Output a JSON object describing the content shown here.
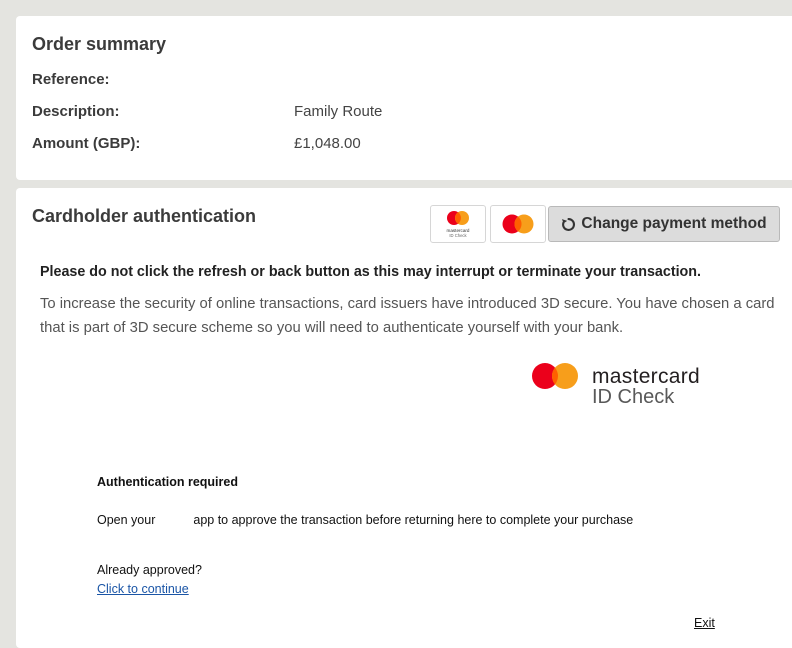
{
  "order_summary": {
    "title": "Order summary",
    "rows": [
      {
        "label": "Reference:",
        "value": ""
      },
      {
        "label": "Description:",
        "value": "Family Route"
      },
      {
        "label": "Amount (GBP):",
        "value": "£1,048.00"
      }
    ]
  },
  "cardholder_auth": {
    "title": "Cardholder authentication",
    "card_icons": [
      "mastercard-id-check-icon",
      "mastercard-icon"
    ],
    "card_tile_small_text": "mastercard\nID Check",
    "change_button_label": "Change payment method",
    "change_button_icon": "refresh-icon",
    "warning": "Please do not click the refresh or back button as this may interrupt or terminate your transaction.",
    "info": "To increase the security of online transactions, card issuers have introduced 3D secure. You have chosen a card that is part of 3D secure scheme so you will need to authenticate yourself with your bank.",
    "logo": {
      "brand": "mastercard",
      "subline": "ID Check",
      "colors": {
        "red": "#eb001b",
        "orange": "#f79e1b",
        "overlap": "#ff5f00",
        "text": "#231f20",
        "subline": "#595959"
      }
    }
  },
  "acs": {
    "heading": "Authentication required",
    "message_before": "Open your",
    "message_after": "app to approve the transaction before returning here to complete your purchase",
    "already_approved": "Already approved?",
    "continue_link": "Click to continue",
    "exit_link": "Exit"
  },
  "colors": {
    "page_background": "#e4e4e0",
    "panel_background": "#ffffff",
    "link": "#1a55a6",
    "button_background": "#dcdcdc"
  }
}
